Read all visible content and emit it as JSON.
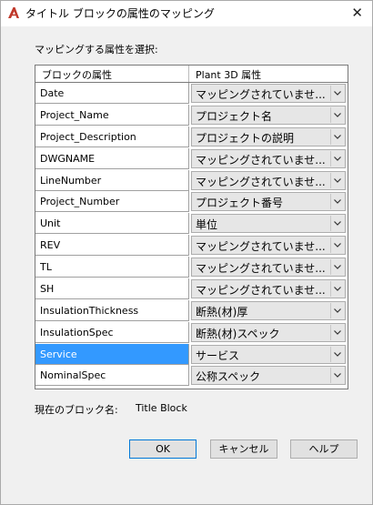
{
  "window": {
    "title": "タイトル ブロックの属性のマッピング",
    "close_glyph": "✕"
  },
  "prompt": "マッピングする属性を選択:",
  "table": {
    "col_block": "ブロックの属性",
    "col_plant": "Plant 3D 属性",
    "rows": [
      {
        "name": "Date",
        "value": "マッピングされていませ..."
      },
      {
        "name": "Project_Name",
        "value": "プロジェクト名"
      },
      {
        "name": "Project_Description",
        "value": "プロジェクトの説明"
      },
      {
        "name": "DWGNAME",
        "value": "マッピングされていませ..."
      },
      {
        "name": "LineNumber",
        "value": "マッピングされていませ..."
      },
      {
        "name": "Project_Number",
        "value": "プロジェクト番号"
      },
      {
        "name": "Unit",
        "value": "単位"
      },
      {
        "name": "REV",
        "value": "マッピングされていませ..."
      },
      {
        "name": "TL",
        "value": "マッピングされていませ..."
      },
      {
        "name": "SH",
        "value": "マッピングされていませ..."
      },
      {
        "name": "InsulationThickness",
        "value": "断熱(材)厚"
      },
      {
        "name": "InsulationSpec",
        "value": "断熱(材)スペック"
      },
      {
        "name": "Service",
        "value": "サービス",
        "selected": true
      },
      {
        "name": "NominalSpec",
        "value": "公称スペック"
      }
    ]
  },
  "current_block": {
    "label": "現在のブロック名:",
    "value": "Title Block"
  },
  "buttons": {
    "ok": "OK",
    "cancel": "キャンセル",
    "help": "ヘルプ"
  },
  "colors": {
    "selection": "#3399ff",
    "default_button_border": "#0078d7",
    "app_icon": "#c0392b"
  }
}
